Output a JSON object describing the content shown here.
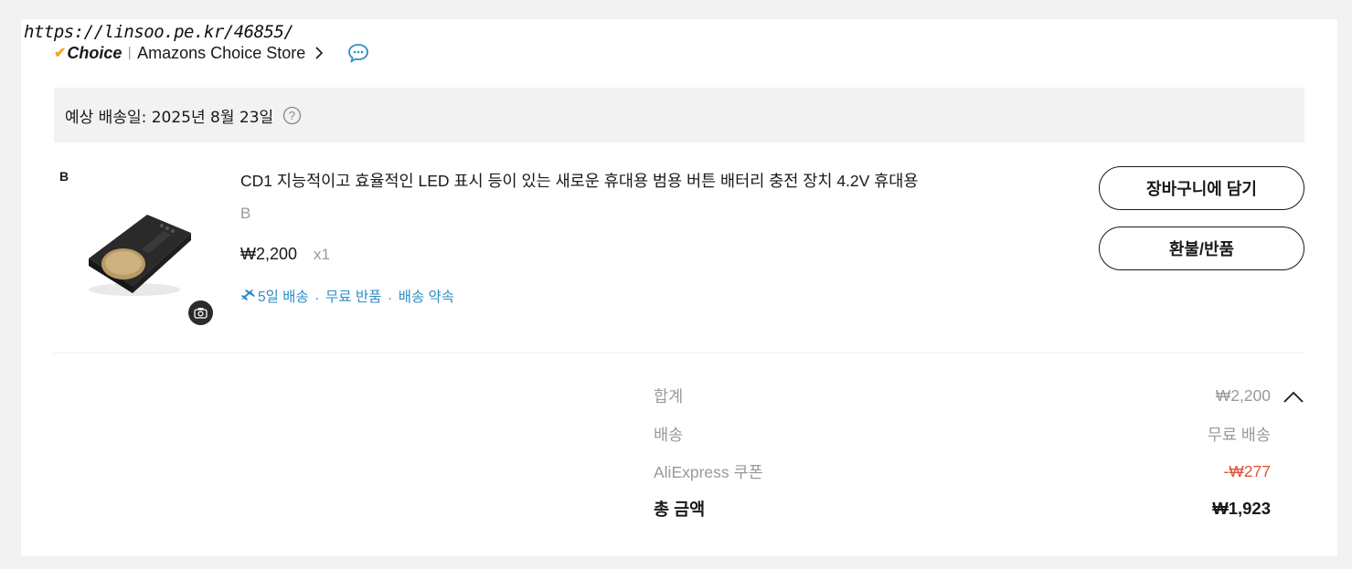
{
  "watermark": "https://linsoo.pe.kr/46855/",
  "store": {
    "choice_logo": "Choice",
    "separator": "|",
    "name": "Amazons Choice Store"
  },
  "delivery": {
    "label": "예상 배송일: 2025년 8월 23일"
  },
  "item": {
    "seller_tag": "B",
    "title": "CD1 지능적이고 효율적인 LED 표시 등이 있는 새로운 휴대용 범용 버튼 배터리 충전 장치 4.2V 휴대용",
    "variant": "B",
    "price": "₩2,200",
    "quantity": "x1",
    "perks": [
      "5일 배송",
      "무료 반품",
      "배송 약속"
    ],
    "perk_separator": "."
  },
  "actions": {
    "add_to_cart": "장바구니에 담기",
    "refund_return": "환불/반품"
  },
  "summary": {
    "subtotal_label": "합계",
    "subtotal_value": "₩2,200",
    "shipping_label": "배송",
    "shipping_value": "무료 배송",
    "coupon_label": "AliExpress 쿠폰",
    "coupon_value": "-₩277",
    "total_label": "총 금액",
    "total_value": "₩1,923"
  },
  "colors": {
    "perk_blue": "#2e8dc8",
    "coupon_red": "#e0513a",
    "choice_check": "#f5a623"
  },
  "icons": [
    "check-icon",
    "chevron-right-icon",
    "chat-icon",
    "help-icon",
    "camera-icon",
    "plane-icon",
    "chevron-up-icon"
  ]
}
